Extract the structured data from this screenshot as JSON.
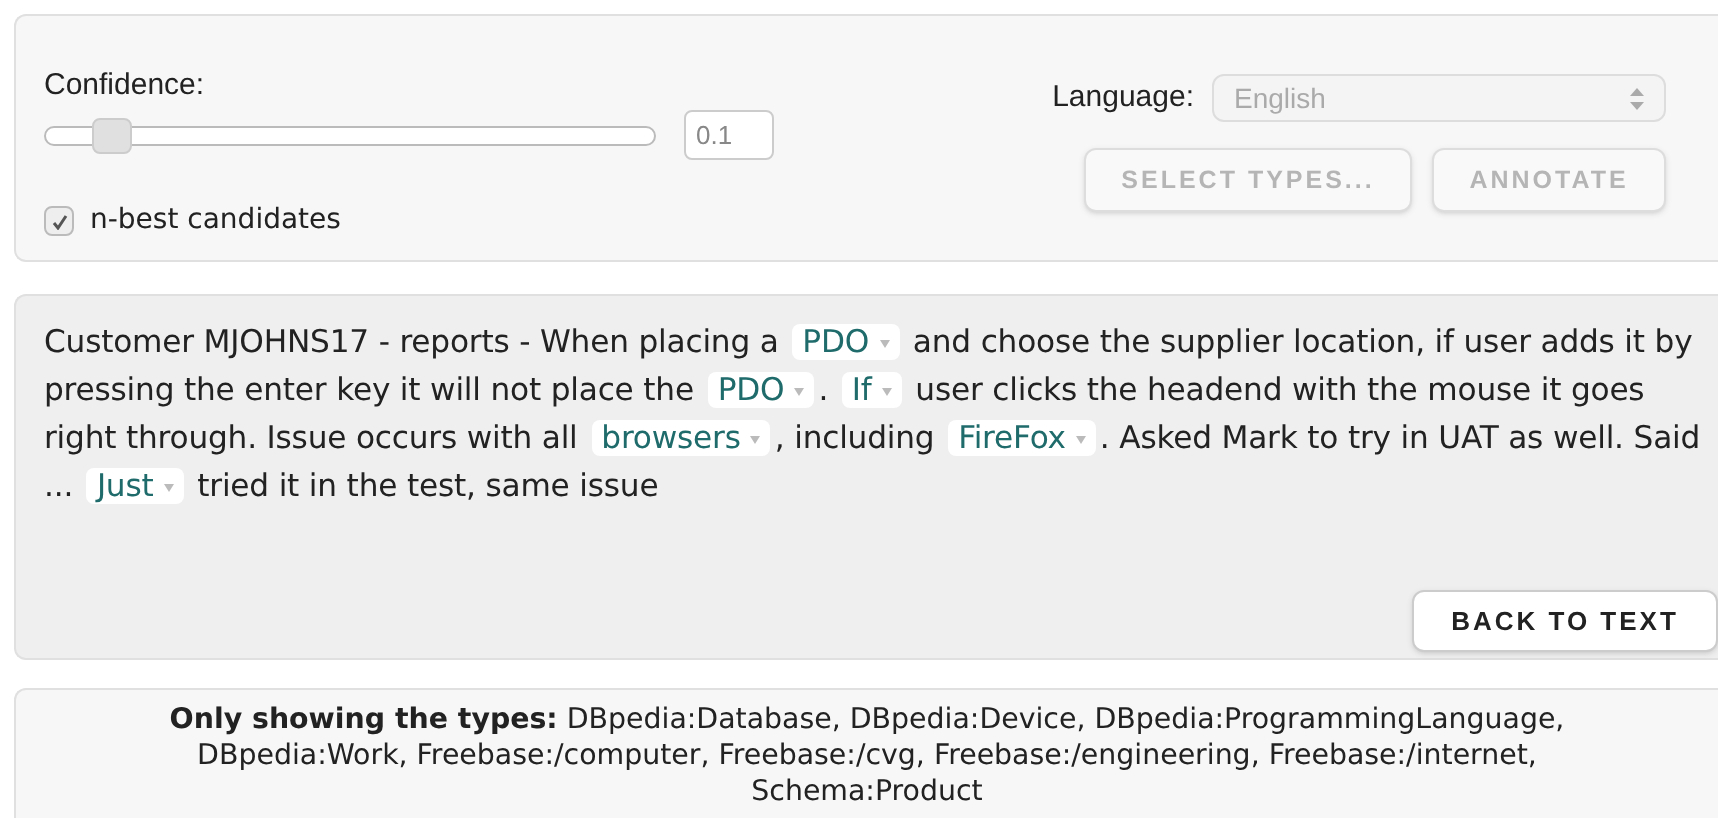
{
  "controls": {
    "confidence_label": "Confidence:",
    "confidence": {
      "level": 0.1
    },
    "confidence_value": "0.1",
    "nbest": {
      "label": "n-best candidates",
      "checked": true
    },
    "language_label": "Language:",
    "language": {
      "value": "English",
      "disabled": true
    },
    "buttons": [
      {
        "label": "SELECT TYPES...",
        "disabled": true
      },
      {
        "label": "ANNOTATE",
        "disabled": true
      }
    ]
  },
  "annotated_text": [
    {
      "kind": "text",
      "text": "Customer MJOHNS17 - reports - When placing a "
    },
    {
      "kind": "tag",
      "text": "PDO"
    },
    {
      "kind": "text",
      "text": " and choose the supplier location, if user adds it by pressing the enter key it will not place the "
    },
    {
      "kind": "tag",
      "text": "PDO"
    },
    {
      "kind": "text",
      "text": ". "
    },
    {
      "kind": "tag",
      "text": "If"
    },
    {
      "kind": "text",
      "text": " user clicks the headend with the mouse it goes right through. Issue occurs with all "
    },
    {
      "kind": "tag",
      "text": "browsers"
    },
    {
      "kind": "text",
      "text": ", including "
    },
    {
      "kind": "tag",
      "text": "FireFox"
    },
    {
      "kind": "text",
      "text": ". Asked Mark to try in UAT as well. Said ... "
    },
    {
      "kind": "tag",
      "text": "Just"
    },
    {
      "kind": "text",
      "text": " tried it in the test, same issue"
    }
  ],
  "back_button": "BACK TO TEXT",
  "types_note": "**Only showing the types:** DBpedia:Database, DBpedia:Device, DBpedia:ProgrammingLanguage, DBpedia:Work, Freebase:/computer, Freebase:/cvg, Freebase:/engineering, Freebase:/internet, Schema:Product"
}
